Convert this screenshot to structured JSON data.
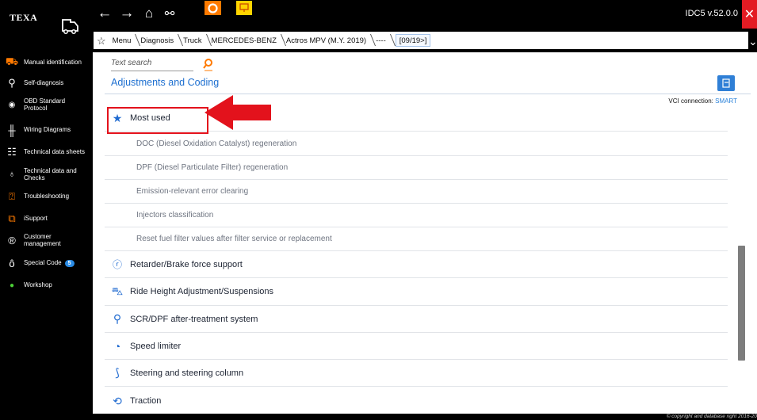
{
  "brand": {
    "logo_text": "TEXA"
  },
  "header": {
    "version": "IDC5 v.52.0.0",
    "close_symbol": "✕",
    "breadcrumbs": [
      "Menu",
      "Diagnosis",
      "Truck",
      "MERCEDES-BENZ",
      "Actros MPV (M.Y. 2019)",
      "----",
      "[09/19>]"
    ]
  },
  "sidebar": {
    "items": [
      {
        "label": "Manual identification",
        "icon": "manual-id-icon"
      },
      {
        "label": "Self-diagnosis",
        "icon": "self-diagnosis-icon"
      },
      {
        "label": "OBD Standard Protocol",
        "icon": "obd-icon"
      },
      {
        "label": "Wiring Diagrams",
        "icon": "wiring-icon"
      },
      {
        "label": "Technical data sheets",
        "icon": "data-sheets-icon"
      },
      {
        "label": "Technical data and Checks",
        "icon": "tech-data-icon"
      },
      {
        "label": "Troubleshooting",
        "icon": "troubleshooting-icon"
      },
      {
        "label": "iSupport",
        "icon": "isupport-icon"
      },
      {
        "label": "Customer management",
        "icon": "customer-icon"
      },
      {
        "label": "Special Code",
        "icon": "special-code-icon",
        "badge": "5"
      },
      {
        "label": "Workshop",
        "icon": "workshop-icon"
      }
    ]
  },
  "main": {
    "search_placeholder": "Text search",
    "title": "Adjustments and Coding",
    "vci_label": "VCI connection:",
    "vci_value": "SMART",
    "most_used": "Most used",
    "sub_items": [
      "DOC (Diesel Oxidation Catalyst) regeneration",
      "DPF (Diesel Particulate Filter) regeneration",
      "Emission-relevant error clearing",
      "Injectors classification",
      "Reset fuel filter values after filter service or replacement"
    ],
    "groups": [
      {
        "label": "Retarder/Brake force support",
        "icon": "retarder-icon"
      },
      {
        "label": "Ride Height Adjustment/Suspensions",
        "icon": "suspension-icon"
      },
      {
        "label": "SCR/DPF after-treatment system",
        "icon": "scr-icon"
      },
      {
        "label": "Speed limiter",
        "icon": "speed-limiter-icon"
      },
      {
        "label": "Steering and steering column",
        "icon": "steering-icon"
      },
      {
        "label": "Traction",
        "icon": "traction-icon"
      }
    ]
  },
  "footer": {
    "copyright": "© copyright and database right 2016-20"
  },
  "colors": {
    "accent": "#1d6fd0",
    "highlight": "#e3121c",
    "close": "#e31b23"
  }
}
